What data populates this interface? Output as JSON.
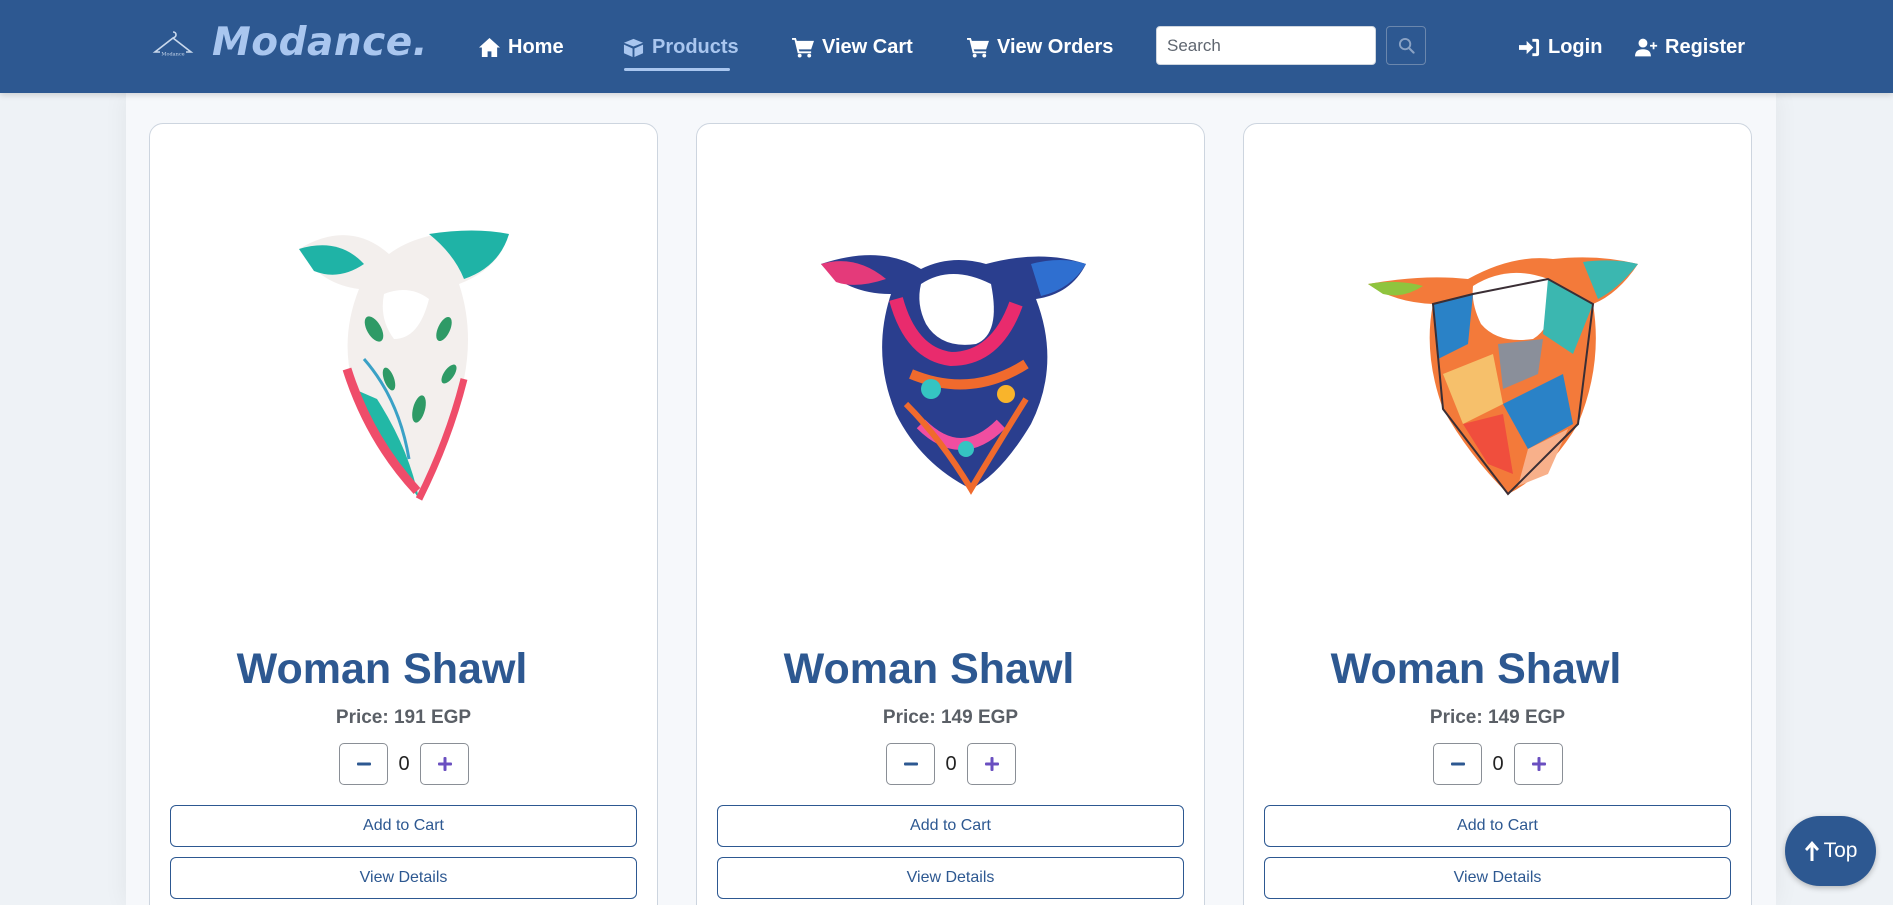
{
  "header": {
    "brand": "Modance.",
    "nav": [
      {
        "label": "Home",
        "icon": "home-icon"
      },
      {
        "label": "Products",
        "icon": "box-icon",
        "active": true
      },
      {
        "label": "View Cart",
        "icon": "cart-icon"
      },
      {
        "label": "View Orders",
        "icon": "cart-icon"
      }
    ],
    "search": {
      "placeholder": "Search",
      "value": ""
    },
    "login_label": "Login",
    "register_label": "Register"
  },
  "products": [
    {
      "title": "Woman Shawl",
      "price": "Price: 191 EGP",
      "qty": "0",
      "add_label": "Add to Cart",
      "details_label": "View Details"
    },
    {
      "title": "Woman Shawl",
      "price": "Price: 149 EGP",
      "qty": "0",
      "add_label": "Add to Cart",
      "details_label": "View Details"
    },
    {
      "title": "Woman Shawl",
      "price": "Price: 149 EGP",
      "qty": "0",
      "add_label": "Add to Cart",
      "details_label": "View Details"
    }
  ],
  "top_button": {
    "label": "Top"
  },
  "colors": {
    "primary": "#2d5891",
    "accent": "#a9c6ef",
    "background": "#eef2f6"
  }
}
